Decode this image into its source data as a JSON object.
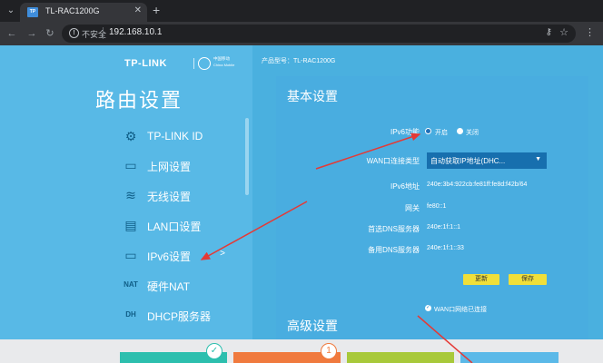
{
  "browser": {
    "tab_title": "TL-RAC1200G",
    "favicon_text": "TP",
    "security_label": "不安全",
    "url": "192.168.10.1"
  },
  "header": {
    "logo": "TP-LINK",
    "partner_name": "中国移动",
    "partner_sub": "China Mobile",
    "product_model": "产品型号：TL-RAC1200G"
  },
  "sidebar": {
    "title": "路由设置",
    "items": [
      {
        "label": "TP-LINK ID",
        "icon": "gear-icon",
        "glyph": "⚙"
      },
      {
        "label": "上网设置",
        "icon": "monitor-icon",
        "glyph": "▭"
      },
      {
        "label": "无线设置",
        "icon": "wifi-icon",
        "glyph": "≋"
      },
      {
        "label": "LAN口设置",
        "icon": "router-icon",
        "glyph": "▤"
      },
      {
        "label": "IPv6设置",
        "icon": "monitor-icon",
        "glyph": "▭",
        "arrow": ">"
      },
      {
        "label": "硬件NAT",
        "icon": "nat-icon",
        "glyph": "NAT"
      },
      {
        "label": "DHCP服务器",
        "icon": "dhcp-icon",
        "glyph": "DH"
      }
    ]
  },
  "basic": {
    "title": "基本设置",
    "ipv6_label": "IPv6功能",
    "on_label": "开启",
    "off_label": "关闭",
    "wan_type_label": "WAN口连接类型",
    "wan_type_value": "自动获取IP地址(DHC...",
    "ipv6_addr_label": "IPv6地址",
    "ipv6_addr_value": "240e:3b4:922cb:fe81ff:fe8d:f42b/64",
    "gateway_label": "网关",
    "gateway_value": "fe80::1",
    "dns1_label": "首选DNS服务器",
    "dns1_value": "240e:1f:1::1",
    "dns2_label": "备用DNS服务器",
    "dns2_value": "240e:1f:1::33",
    "refresh_button": "更新",
    "save_button": "保存",
    "wan_check_label": "WAN口网络已连接"
  },
  "advanced": {
    "title": "高级设置"
  },
  "steps": {
    "step2_badge": "1",
    "step1_badge": "✓"
  },
  "colors": {
    "sidebar_bg": "#58b9e6",
    "main_bg": "#4ab0df",
    "button_yellow": "#f0df3a",
    "select_bg": "#176fae",
    "arrow_red": "#e53935"
  }
}
